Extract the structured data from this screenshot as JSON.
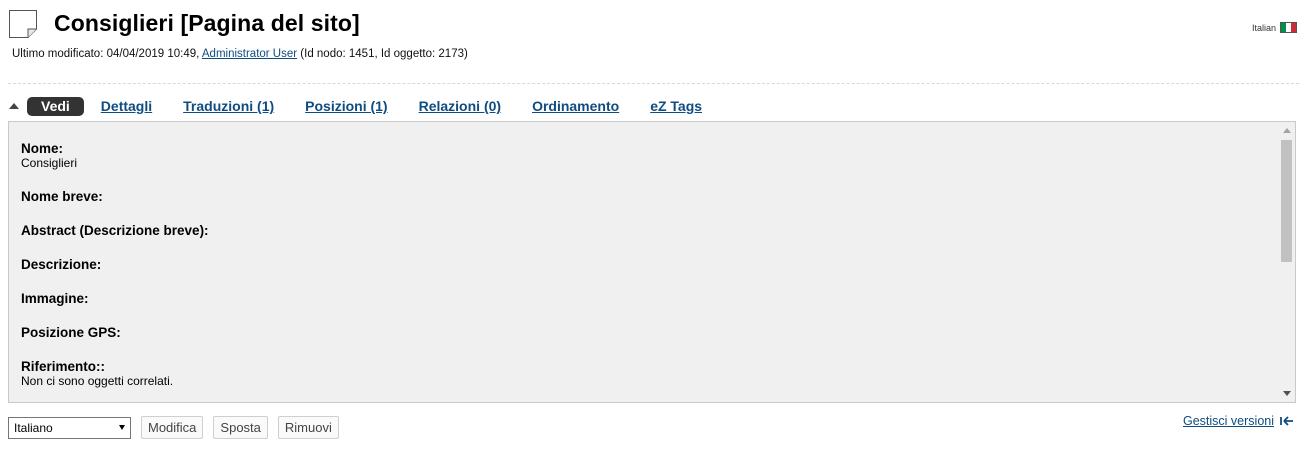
{
  "header": {
    "title": "Consiglieri [Pagina del sito]",
    "language_label": "Italian",
    "flag_colors": [
      "#009246",
      "#ffffff",
      "#ce2b37"
    ]
  },
  "meta": {
    "modified_prefix": "Ultimo modificato: 04/04/2019 10:49,",
    "author": "Administrator User",
    "ids": "(Id nodo: 1451, Id oggetto: 2173)"
  },
  "tabs": [
    {
      "label": "Vedi",
      "active": true
    },
    {
      "label": "Dettagli"
    },
    {
      "label": "Traduzioni (1)"
    },
    {
      "label": "Posizioni (1)"
    },
    {
      "label": "Relazioni (0)"
    },
    {
      "label": "Ordinamento"
    },
    {
      "label": "eZ Tags"
    }
  ],
  "fields": [
    {
      "label": "Nome:",
      "value": "Consiglieri"
    },
    {
      "label": "Nome breve:",
      "value": ""
    },
    {
      "label": "Abstract (Descrizione breve):",
      "value": ""
    },
    {
      "label": "Descrizione:",
      "value": ""
    },
    {
      "label": "Immagine:",
      "value": ""
    },
    {
      "label": "Posizione GPS:",
      "value": ""
    },
    {
      "label": "Riferimento::",
      "value": "Non ci sono oggetti correlati."
    }
  ],
  "actions": {
    "language_select": "Italiano",
    "edit": "Modifica",
    "move": "Sposta",
    "remove": "Rimuovi"
  },
  "versions_link": "Gestisci versioni"
}
